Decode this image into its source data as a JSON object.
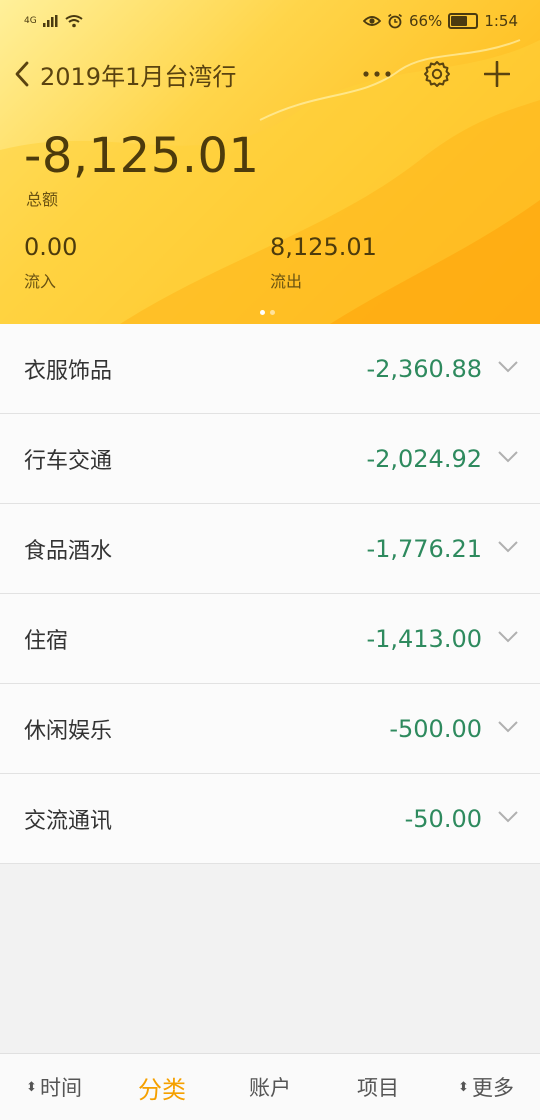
{
  "status_bar": {
    "network": "4G",
    "battery": "66%",
    "time": "1:54"
  },
  "nav": {
    "title": "2019年1月台湾行",
    "icons": [
      "back-icon",
      "more-icon",
      "settings-icon",
      "add-icon"
    ]
  },
  "summary": {
    "total": "-8,125.01",
    "total_label": "总额",
    "inflow": "0.00",
    "inflow_label": "流入",
    "outflow": "8,125.01",
    "outflow_label": "流出"
  },
  "pager": {
    "pages": 2,
    "current": 1
  },
  "categories": [
    {
      "name": "衣服饰品",
      "amount": "-2,360.88"
    },
    {
      "name": "行车交通",
      "amount": "-2,024.92"
    },
    {
      "name": "食品酒水",
      "amount": "-1,776.21"
    },
    {
      "name": "住宿",
      "amount": "-1,413.00"
    },
    {
      "name": "休闲娱乐",
      "amount": "-500.00"
    },
    {
      "name": "交流通讯",
      "amount": "-50.00"
    }
  ],
  "tabs": [
    {
      "label": "时间",
      "sortable": true
    },
    {
      "label": "分类",
      "active": true
    },
    {
      "label": "账户"
    },
    {
      "label": "项目"
    },
    {
      "label": "更多",
      "sortable": true
    }
  ],
  "colors": {
    "header_gradient_start": "#fff09a",
    "header_gradient_end": "#ffaa10",
    "amount": "#2e8a5e",
    "active_tab": "#f5a000"
  }
}
